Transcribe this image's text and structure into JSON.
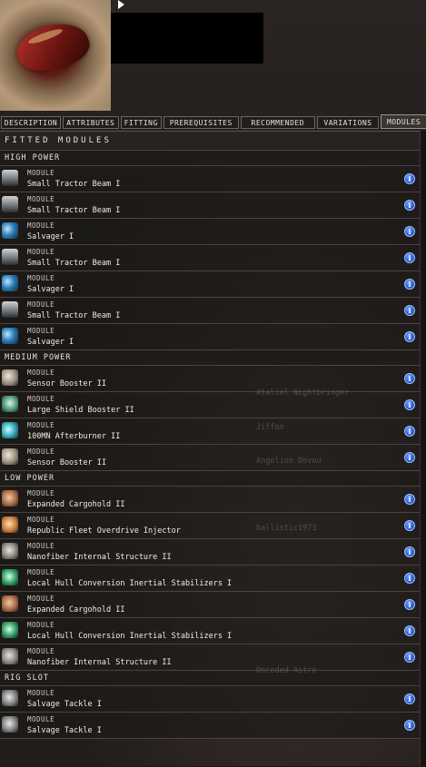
{
  "tabs": [
    "DESCRIPTION",
    "ATTRIBUTES",
    "FITTING",
    "PREREQUISITES",
    "RECOMMENDED",
    "VARIATIONS",
    "MODULES"
  ],
  "active_tab": "MODULES",
  "panel_title": "FITTED MODULES",
  "kind_label": "MODULE",
  "sections": [
    {
      "title": "HIGH POWER",
      "modules": [
        {
          "name": "Small Tractor Beam I",
          "icon": "tractor-beam-icon"
        },
        {
          "name": "Small Tractor Beam I",
          "icon": "tractor-beam-icon"
        },
        {
          "name": "Salvager I",
          "icon": "salvager-icon"
        },
        {
          "name": "Small Tractor Beam I",
          "icon": "tractor-beam-icon"
        },
        {
          "name": "Salvager I",
          "icon": "salvager-icon"
        },
        {
          "name": "Small Tractor Beam I",
          "icon": "tractor-beam-icon"
        },
        {
          "name": "Salvager I",
          "icon": "salvager-icon"
        }
      ]
    },
    {
      "title": "MEDIUM POWER",
      "modules": [
        {
          "name": "Sensor Booster II",
          "icon": "sensor-booster-icon"
        },
        {
          "name": "Large Shield Booster II",
          "icon": "shield-booster-icon"
        },
        {
          "name": "100MN Afterburner II",
          "icon": "afterburner-icon"
        },
        {
          "name": "Sensor Booster II",
          "icon": "sensor-booster-icon"
        }
      ]
    },
    {
      "title": "LOW POWER",
      "modules": [
        {
          "name": "Expanded Cargohold II",
          "icon": "cargohold-icon"
        },
        {
          "name": "Republic Fleet Overdrive Injector",
          "icon": "overdrive-injector-icon"
        },
        {
          "name": "Nanofiber Internal Structure II",
          "icon": "nanofiber-icon"
        },
        {
          "name": "Local Hull Conversion Inertial Stabilizers I",
          "icon": "inertial-stabilizer-icon"
        },
        {
          "name": "Expanded Cargohold II",
          "icon": "cargohold-icon"
        },
        {
          "name": "Local Hull Conversion Inertial Stabilizers I",
          "icon": "inertial-stabilizer-icon"
        },
        {
          "name": "Nanofiber Internal Structure II",
          "icon": "nanofiber-icon"
        }
      ]
    },
    {
      "title": "RIG SLOT",
      "modules": [
        {
          "name": "Salvage Tackle I",
          "icon": "salvage-tackle-icon"
        },
        {
          "name": "Salvage Tackle I",
          "icon": "salvage-tackle-icon"
        }
      ]
    }
  ],
  "background_text": [
    "Ataliel Nightbringer",
    "Jiffon",
    "Angelion Dovou",
    "ballistic1973",
    "Oncoded Astro"
  ],
  "colors": {
    "info_button": "#2a5bd8",
    "panel_bg": "#1e1a18",
    "text": "#f0ece4"
  }
}
